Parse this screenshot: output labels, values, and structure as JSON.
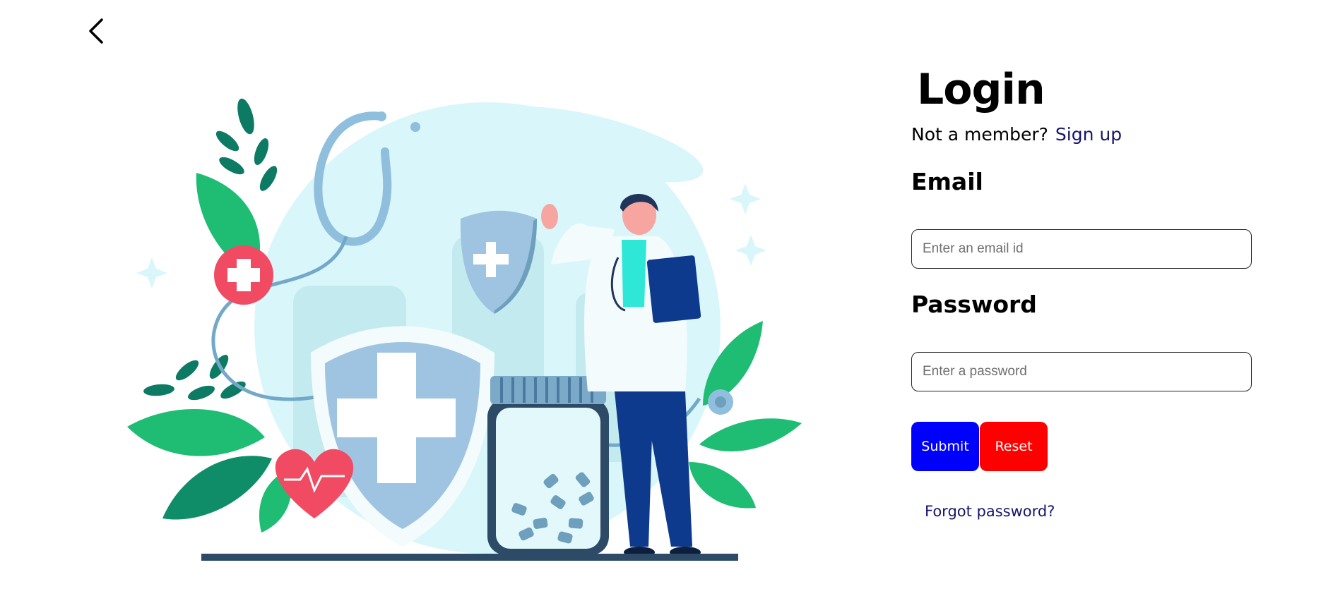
{
  "nav": {
    "back_icon": "chevron-left-icon"
  },
  "login": {
    "title": "Login",
    "member_prompt": "Not a member?",
    "signup_label": "Sign up",
    "email_label": "Email",
    "email_placeholder": "Enter an email id",
    "password_label": "Password",
    "password_placeholder": "Enter a password",
    "submit_label": "Submit",
    "reset_label": "Reset",
    "forgot_label": "Forgot password?"
  },
  "colors": {
    "submit": "#0000ff",
    "reset": "#ff0000",
    "link": "#15156b"
  }
}
